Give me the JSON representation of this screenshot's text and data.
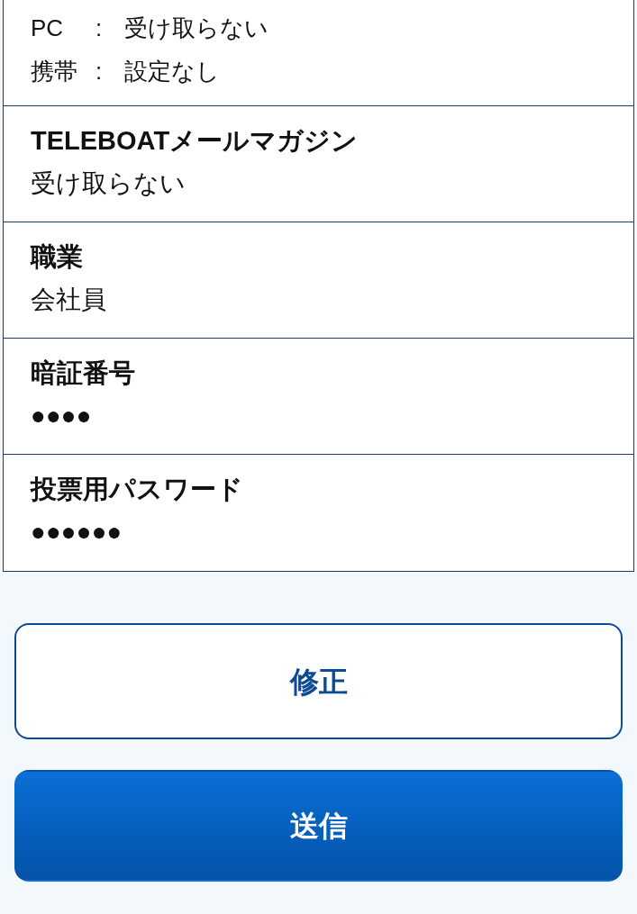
{
  "notification_settings": [
    {
      "device": "PC",
      "separator": ":",
      "value": "受け取らない"
    },
    {
      "device": "携帯",
      "separator": ":",
      "value": "設定なし"
    }
  ],
  "fields": [
    {
      "label": "TELEBOATメールマガジン",
      "value": "受け取らない"
    },
    {
      "label": "職業",
      "value": "会社員"
    },
    {
      "label": "暗証番号",
      "value": "●●●●"
    },
    {
      "label": "投票用パスワード",
      "value": "●●●●●●"
    }
  ],
  "buttons": [
    {
      "label": "修正",
      "kind": "secondary"
    },
    {
      "label": "送信",
      "kind": "primary"
    }
  ]
}
